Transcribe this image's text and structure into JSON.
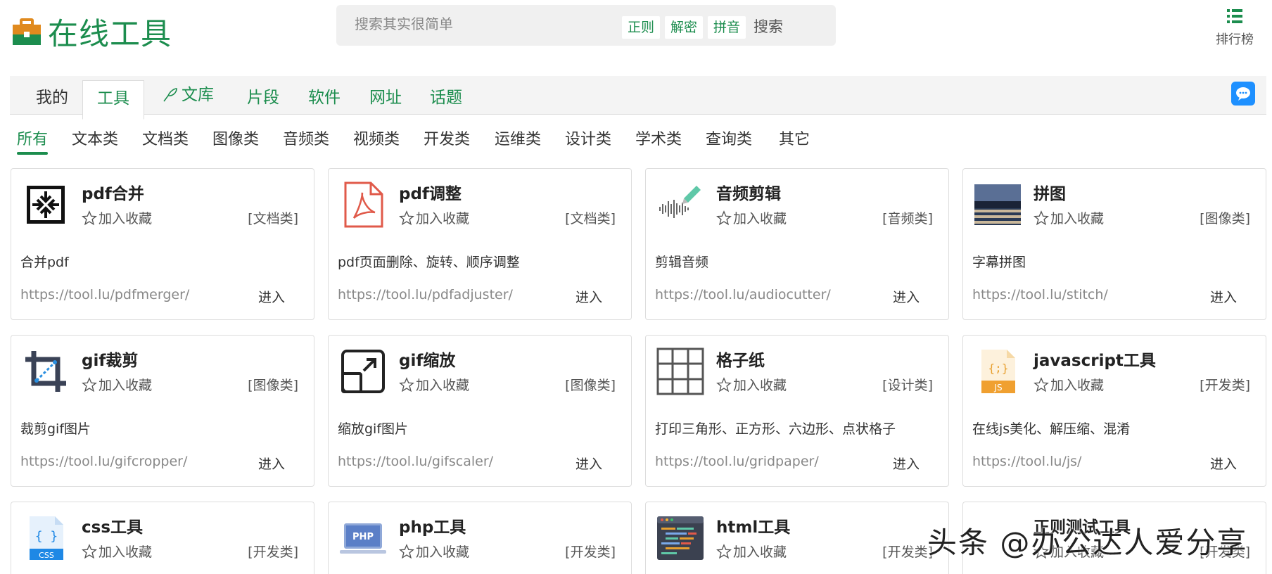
{
  "header": {
    "logo_text": "在线工具",
    "search_placeholder": "搜索其实很简单",
    "search_tags": [
      "正则",
      "解密",
      "拼音"
    ],
    "search_button": "搜索",
    "rank_label": "排行榜"
  },
  "nav": {
    "items": [
      "我的",
      "工具",
      "文库",
      "片段",
      "软件",
      "网址",
      "话题"
    ],
    "active": "工具"
  },
  "categories": {
    "items": [
      "所有",
      "文本类",
      "文档类",
      "图像类",
      "音频类",
      "视频类",
      "开发类",
      "运维类",
      "设计类",
      "学术类",
      "查询类",
      "其它"
    ],
    "active": "所有"
  },
  "favorite_label": "加入收藏",
  "enter_label": "进入",
  "cards": [
    {
      "title": "pdf合并",
      "category": "[文档类]",
      "desc": "合并pdf",
      "url": "https://tool.lu/pdfmerger/",
      "icon": "pdf-merge-icon"
    },
    {
      "title": "pdf调整",
      "category": "[文档类]",
      "desc": "pdf页面删除、旋转、顺序调整",
      "url": "https://tool.lu/pdfadjuster/",
      "icon": "pdf-file-icon"
    },
    {
      "title": "音频剪辑",
      "category": "[音频类]",
      "desc": "剪辑音频",
      "url": "https://tool.lu/audiocutter/",
      "icon": "audio-wave-icon"
    },
    {
      "title": "拼图",
      "category": "[图像类]",
      "desc": "字幕拼图",
      "url": "https://tool.lu/stitch/",
      "icon": "photo-stitch-icon"
    },
    {
      "title": "gif裁剪",
      "category": "[图像类]",
      "desc": "裁剪gif图片",
      "url": "https://tool.lu/gifcropper/",
      "icon": "crop-icon"
    },
    {
      "title": "gif缩放",
      "category": "[图像类]",
      "desc": "缩放gif图片",
      "url": "https://tool.lu/gifscaler/",
      "icon": "scale-icon"
    },
    {
      "title": "格子纸",
      "category": "[设计类]",
      "desc": "打印三角形、正方形、六边形、点状格子",
      "url": "https://tool.lu/gridpaper/",
      "icon": "grid-icon"
    },
    {
      "title": "javascript工具",
      "category": "[开发类]",
      "desc": "在线js美化、解压缩、混淆",
      "url": "https://tool.lu/js/",
      "icon": "js-file-icon"
    },
    {
      "title": "css工具",
      "category": "[开发类]",
      "desc": "",
      "url": "",
      "icon": "css-file-icon"
    },
    {
      "title": "php工具",
      "category": "[开发类]",
      "desc": "",
      "url": "",
      "icon": "php-laptop-icon"
    },
    {
      "title": "html工具",
      "category": "[开发类]",
      "desc": "",
      "url": "",
      "icon": "html-code-icon"
    },
    {
      "title": "正则测试工具",
      "category": "[开发类]",
      "desc": "",
      "url": "",
      "icon": "regex-icon"
    }
  ],
  "watermark": "头条 @办公达人爱分享",
  "colors": {
    "brand": "#1c8d4e",
    "chat": "#1e90ff",
    "js": "#f0a030",
    "css": "#1e88e5",
    "php": "#5b7fc7"
  }
}
